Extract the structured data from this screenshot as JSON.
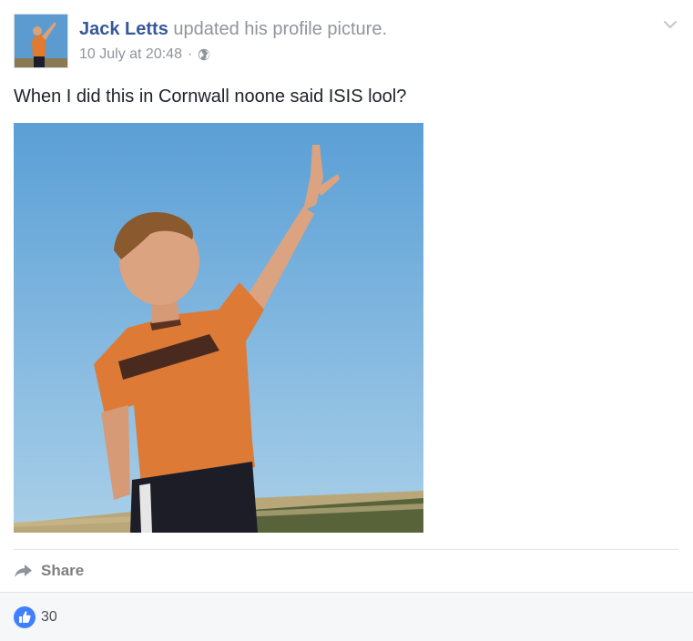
{
  "post": {
    "author": "Jack Letts",
    "action": "updated his profile picture.",
    "timestamp": "10 July at 20:48",
    "separator": "·",
    "audience_icon": "globe-icon",
    "text": "When I did this in Cornwall noone said ISIS lool?",
    "options_icon": "chevron-down-icon"
  },
  "actions": {
    "share_label": "Share",
    "share_icon": "share-arrow-icon"
  },
  "reactions": {
    "like_icon": "thumbs-up-icon",
    "count": "30"
  },
  "colors": {
    "link_blue": "#365899",
    "secondary_text": "#90949c",
    "body_text": "#1d2129",
    "like_blue": "#4080ff",
    "footer_bg": "#f6f7f9"
  }
}
